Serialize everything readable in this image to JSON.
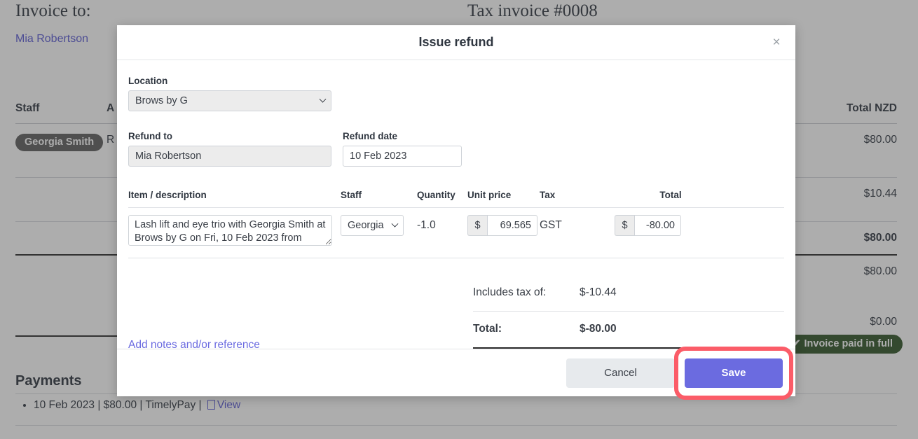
{
  "background": {
    "invoice_to_heading": "Invoice to:",
    "tax_invoice_heading": "Tax invoice #0008",
    "customer_name": "Mia Robertson",
    "table": {
      "headers": {
        "staff": "Staff",
        "amount": "A",
        "total": "Total NZD"
      },
      "rows": [
        {
          "staff": "Georgia Smith",
          "desc": "R",
          "total": "$80.00",
          "bold": false
        },
        {
          "staff": "",
          "desc": "",
          "total": "$10.44",
          "bold": false
        },
        {
          "staff": "",
          "desc": "",
          "total": "$80.00",
          "bold": true
        },
        {
          "staff": "",
          "desc": "",
          "total": "$80.00",
          "bold": false
        },
        {
          "staff": "",
          "desc": "",
          "total": "$0.00",
          "bold": false
        }
      ]
    },
    "paid_badge": "Invoice paid in full",
    "paid_badge_check": "✔",
    "payments_heading": "Payments",
    "payment_line_prefix": "10 Feb 2023 | $80.00 | TimelyPay | ",
    "payment_view_link": "View"
  },
  "modal": {
    "title": "Issue refund",
    "close_label": "×",
    "location": {
      "label": "Location",
      "value": "Brows by G",
      "options": [
        "Brows by G"
      ]
    },
    "refund_to": {
      "label": "Refund to",
      "value": "Mia Robertson"
    },
    "refund_date": {
      "label": "Refund date",
      "value": "10 Feb 2023"
    },
    "item_table": {
      "headers": {
        "item": "Item / description",
        "staff": "Staff",
        "quantity": "Quantity",
        "unit_price": "Unit price",
        "tax": "Tax",
        "total": "Total"
      },
      "row": {
        "description": "Lash lift and eye trio with Georgia Smith at Brows by G on Fri, 10 Feb 2023 from",
        "staff": "Georgia Smith",
        "staff_options": [
          "Georgia Smith"
        ],
        "quantity": "-1.0",
        "currency_symbol": "$",
        "unit_price": "69.565",
        "tax": "GST",
        "total": "-80.00"
      }
    },
    "totals": {
      "includes_tax_label": "Includes tax of:",
      "includes_tax_value": "$-10.44",
      "total_label": "Total:",
      "total_value": "$-80.00"
    },
    "add_notes_link": "Add notes and/or reference",
    "cancel_label": "Cancel",
    "save_label": "Save"
  },
  "colors": {
    "accent_purple": "#6b6be0",
    "highlight_ring": "#fb5c68",
    "paid_green": "#2f5426"
  }
}
